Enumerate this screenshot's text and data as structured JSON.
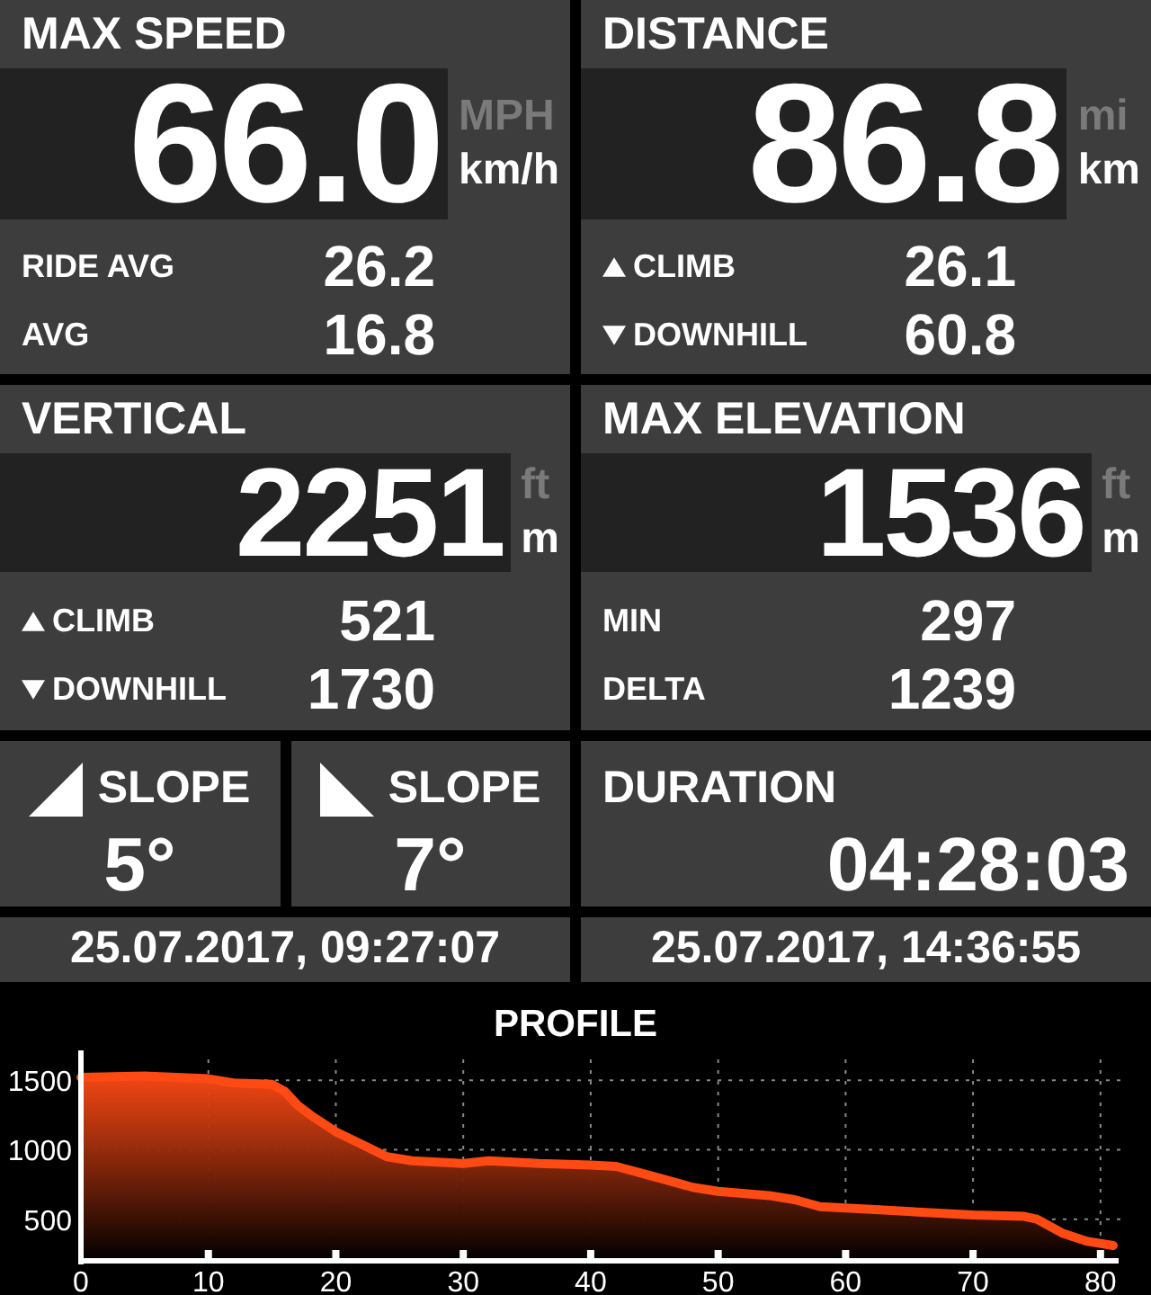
{
  "panels": [
    {
      "title": "MAX SPEED",
      "value": "66.0",
      "units": [
        {
          "label": "MPH",
          "selected": false
        },
        {
          "label": "km/h",
          "selected": true
        }
      ],
      "rows": [
        {
          "kind": "plain",
          "label": "RIDE AVG",
          "value": "26.2"
        },
        {
          "kind": "plain",
          "label": "AVG",
          "value": "16.8"
        }
      ]
    },
    {
      "title": "DISTANCE",
      "value": "86.8",
      "units": [
        {
          "label": "mi",
          "selected": false
        },
        {
          "label": "km",
          "selected": true
        }
      ],
      "rows": [
        {
          "kind": "up",
          "label": "CLIMB",
          "value": "26.1"
        },
        {
          "kind": "down",
          "label": "DOWNHILL",
          "value": "60.8"
        }
      ]
    },
    {
      "title": "VERTICAL",
      "value": "2251",
      "units": [
        {
          "label": "ft",
          "selected": false
        },
        {
          "label": "m",
          "selected": true
        }
      ],
      "rows": [
        {
          "kind": "up",
          "label": "CLIMB",
          "value": "521"
        },
        {
          "kind": "down",
          "label": "DOWNHILL",
          "value": "1730"
        }
      ]
    },
    {
      "title": "MAX ELEVATION",
      "value": "1536",
      "units": [
        {
          "label": "ft",
          "selected": false
        },
        {
          "label": "m",
          "selected": true
        }
      ],
      "rows": [
        {
          "kind": "plain",
          "label": "MIN",
          "value": "297"
        },
        {
          "kind": "plain",
          "label": "DELTA",
          "value": "1239"
        }
      ]
    }
  ],
  "slopes": [
    {
      "kind": "up",
      "title": "SLOPE",
      "value": "5°"
    },
    {
      "kind": "down",
      "title": "SLOPE",
      "value": "7°"
    }
  ],
  "duration": {
    "title": "DURATION",
    "value": "04:28:03"
  },
  "dates": [
    "25.07.2017, 09:27:07",
    "25.07.2017, 14:36:55"
  ],
  "profile": {
    "chart_data": {
      "type": "area",
      "title": "PROFILE",
      "grid": true,
      "xlim": [
        0,
        81
      ],
      "ylim": [
        200,
        1650
      ],
      "xticks": [
        0,
        10,
        20,
        30,
        40,
        50,
        60,
        70,
        80
      ],
      "yticks": [
        500,
        1000,
        1500
      ],
      "x": [
        0,
        5,
        10,
        12,
        15,
        16,
        17,
        18,
        20,
        22,
        24,
        26,
        30,
        32,
        36,
        40,
        42,
        44,
        46,
        48,
        50,
        54,
        56,
        58,
        62,
        66,
        70,
        74,
        75,
        77,
        79,
        81
      ],
      "series": [
        {
          "color": "#ff4a14",
          "values": [
            1520,
            1530,
            1510,
            1480,
            1470,
            1420,
            1320,
            1250,
            1130,
            1040,
            950,
            920,
            900,
            920,
            900,
            890,
            880,
            830,
            780,
            730,
            700,
            670,
            640,
            590,
            570,
            550,
            530,
            520,
            500,
            400,
            340,
            310
          ]
        }
      ]
    }
  }
}
